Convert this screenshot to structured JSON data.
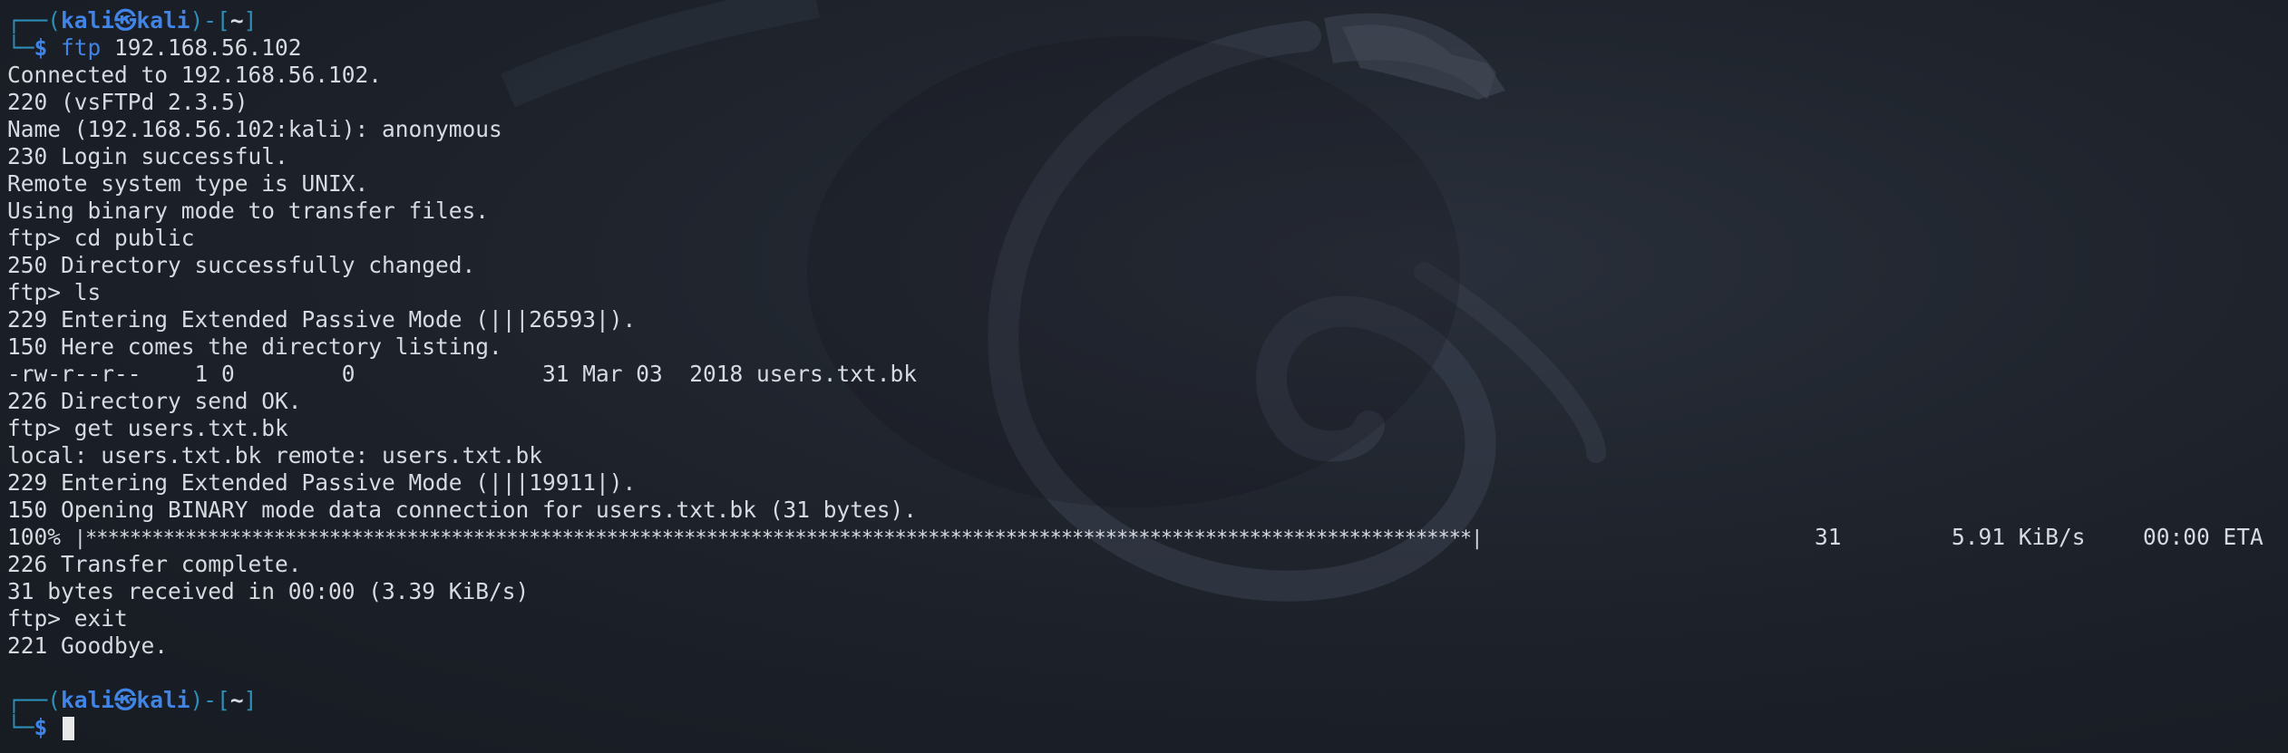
{
  "prompt": {
    "top_prefix": "┌──(",
    "user": "kali",
    "at_icon": "㉿",
    "host": "kali",
    "mid": ")-[",
    "dir": "~",
    "close": "]",
    "bottom_prefix": "└─",
    "dollar": "$ "
  },
  "session1": {
    "command_name": "ftp",
    "command_args": " 192.168.56.102",
    "output": [
      "Connected to 192.168.56.102.",
      "220 (vsFTPd 2.3.5)",
      "Name (192.168.56.102:kali): anonymous",
      "230 Login successful.",
      "Remote system type is UNIX.",
      "Using binary mode to transfer files.",
      "ftp> cd public",
      "250 Directory successfully changed.",
      "ftp> ls",
      "229 Entering Extended Passive Mode (|||26593|).",
      "150 Here comes the directory listing.",
      "-rw-r--r--    1 0        0              31 Mar 03  2018 users.txt.bk",
      "226 Directory send OK.",
      "ftp> get users.txt.bk",
      "local: users.txt.bk remote: users.txt.bk",
      "229 Entering Extended Passive Mode (|||19911|).",
      "150 Opening BINARY mode data connection for users.txt.bk (31 bytes)."
    ],
    "progress": {
      "percent": "100%",
      "bar": "|*****************************************************************************************************************************|",
      "bytes": "31",
      "rate": "5.91 KiB/s",
      "eta": "00:00 ETA"
    },
    "output_after": [
      "226 Transfer complete.",
      "31 bytes received in 00:00 (3.39 KiB/s)",
      "ftp> exit",
      "221 Goodbye."
    ]
  },
  "icons": {
    "wallpaper": "kali-dragon-icon",
    "cursor": "block-cursor"
  },
  "colors": {
    "background": "#1b1f27",
    "text": "#d7dae0",
    "prompt_frame": "#2d8eb8",
    "prompt_user": "#3f84e6"
  }
}
